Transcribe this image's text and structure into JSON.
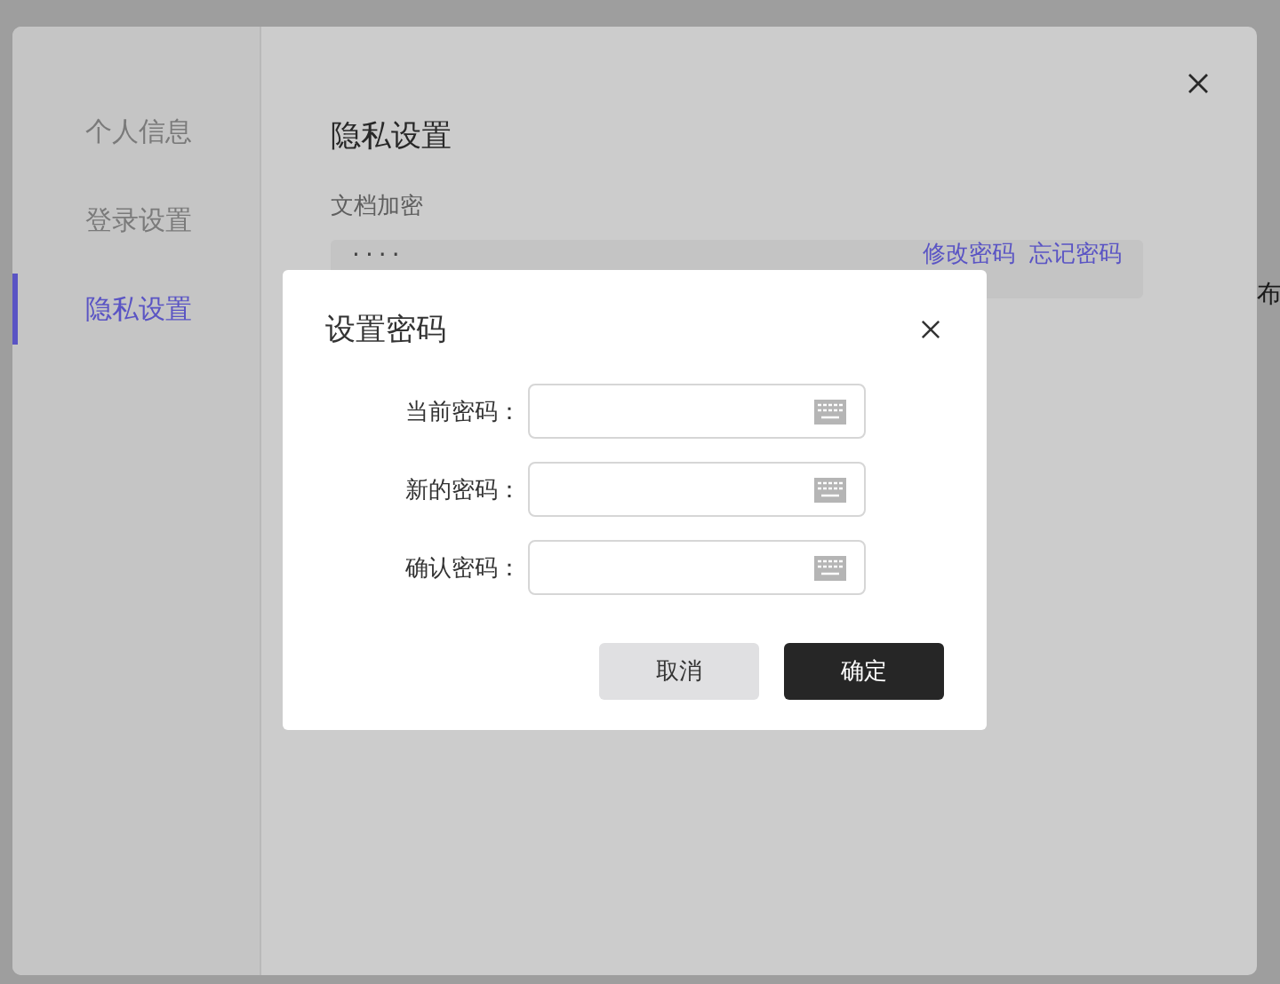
{
  "sidebar": {
    "items": [
      {
        "label": "个人信息",
        "selected": false
      },
      {
        "label": "登录设置",
        "selected": false
      },
      {
        "label": "隐私设置",
        "selected": true
      }
    ]
  },
  "main": {
    "title": "隐私设置",
    "section": "文档加密",
    "password_mask": "····",
    "links": [
      "修改密码",
      "忘记密码"
    ],
    "edge_text": "布"
  },
  "dialog": {
    "title": "设置密码",
    "fields": [
      {
        "label": "当前密码："
      },
      {
        "label": "新的密码："
      },
      {
        "label": "确认密码："
      }
    ],
    "buttons": [
      {
        "label": "取消",
        "kind": "secondary"
      },
      {
        "label": "确定",
        "kind": "primary"
      }
    ]
  }
}
